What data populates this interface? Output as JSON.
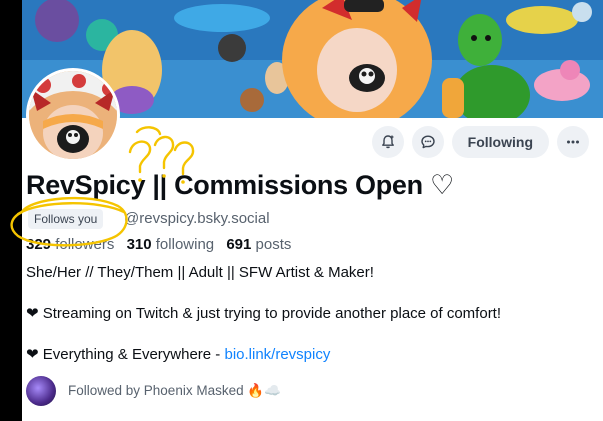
{
  "profile": {
    "display_name": "RevSpicy || Commissions Open ♡",
    "follows_you": "Follows you",
    "handle": "@revspicy.bsky.social",
    "stats": {
      "followers_count": "329",
      "followers_label": "followers",
      "following_count": "310",
      "following_label": "following",
      "posts_count": "691",
      "posts_label": "posts"
    },
    "bio_lines": [
      "She/Her // They/Them || Adult || SFW Artist & Maker!",
      "❤ Streaming on Twitch & just trying to provide another place of comfort!"
    ],
    "bio_line3_prefix": "❤ Everything & Everywhere - ",
    "bio_link": "bio.link/revspicy",
    "followed_by": "Followed by Phoenix Masked 🔥☁️"
  },
  "actions": {
    "following_label": "Following"
  },
  "icons": {
    "notify": "bell-plus-icon",
    "message": "chat-bubble-icon",
    "more": "ellipsis-icon"
  },
  "colors": {
    "accent": "#1083fe",
    "button_bg": "#eef1f5",
    "scribble": "#f5c400"
  }
}
